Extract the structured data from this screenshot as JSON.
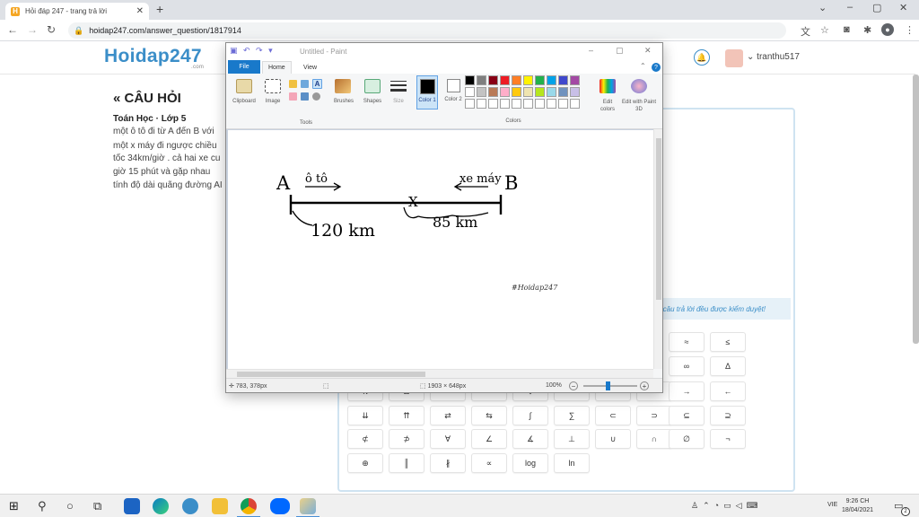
{
  "browser": {
    "tab_title": "Hỏi đáp 247 - trang trả lời",
    "tab_close": "✕",
    "new_tab": "+",
    "url": "hoidap247.com/answer_question/1817914"
  },
  "site": {
    "logo": "Hoidap247",
    "logo_sub": ".com",
    "username": "tranthu517"
  },
  "question": {
    "heading": "« CÂU HỎI",
    "subject": "Toán Học · Lớp 5",
    "lines": [
      "một ô tô đi từ A đến B với",
      "một x máy đi ngược chiều",
      "tốc 34km/giờ . cả hai xe cu",
      "giờ 15 phút và gặp nhau",
      "tính độ dài quãng đường AI"
    ]
  },
  "answer_notice": "ả câu trả lời đều được kiểm duyệt!",
  "keypad": {
    "rows": [
      [
        "",
        "",
        "",
        "",
        "",
        "",
        "",
        "",
        "≈",
        "≤"
      ],
      [
        "",
        "",
        "",
        "",
        "",
        "",
        "",
        "",
        "∞",
        "Δ"
      ],
      [
        "π",
        "Ω",
        "",
        "",
        "↓",
        "",
        "",
        "",
        "→",
        "←"
      ],
      [
        "⇊",
        "⇈",
        "⇄",
        "⇆",
        "∫",
        "∑",
        "⊂",
        "⊃",
        "⊆",
        "⊇"
      ],
      [
        "⊄",
        "⊅",
        "∀",
        "∠",
        "∡",
        "⊥",
        "∪",
        "∩",
        "∅",
        "¬"
      ],
      [
        "⊕",
        "║",
        "∦",
        "∝",
        "log",
        "ln",
        "",
        "",
        "",
        ""
      ]
    ]
  },
  "paint": {
    "title": "Untitled - Paint",
    "tabs": {
      "file": "File",
      "home": "Home",
      "view": "View"
    },
    "groups": {
      "clipboard": "Clipboard",
      "image": "Image",
      "tools": "Tools",
      "brushes": "Brushes",
      "shapes": "Shapes",
      "size": "Size",
      "color1": "Color 1",
      "color2": "Color 2",
      "colors": "Colors",
      "edit_colors": "Edit colors",
      "edit_paint3d": "Edit with Paint 3D"
    },
    "palette": [
      "#000000",
      "#7f7f7f",
      "#880015",
      "#ed1c24",
      "#ff7f27",
      "#fff200",
      "#22b14c",
      "#00a2e8",
      "#3f48cc",
      "#a349a4",
      "#ffffff",
      "#c3c3c3",
      "#b97a57",
      "#ffaec9",
      "#ffc90e",
      "#efe4b0",
      "#b5e61d",
      "#99d9ea",
      "#7092be",
      "#c8bfe7",
      "#ffffff",
      "#ffffff",
      "#ffffff",
      "#ffffff",
      "#ffffff",
      "#ffffff",
      "#ffffff",
      "#ffffff",
      "#ffffff",
      "#ffffff"
    ],
    "drawing": {
      "point_a": "A",
      "point_b": "B",
      "car_label": "ô tô",
      "bike_label": "xe máy",
      "meet_mark": "X",
      "dist_left": "120 km",
      "dist_right": "85 km",
      "watermark": "#Hoidap247"
    },
    "status": {
      "cursor": "783, 378px",
      "canvas_size": "1903 × 648px",
      "zoom": "100%"
    }
  },
  "taskbar": {
    "time": "9:26 CH",
    "date": "18/04/2021",
    "lang": "VIE",
    "notif_count": "2"
  }
}
